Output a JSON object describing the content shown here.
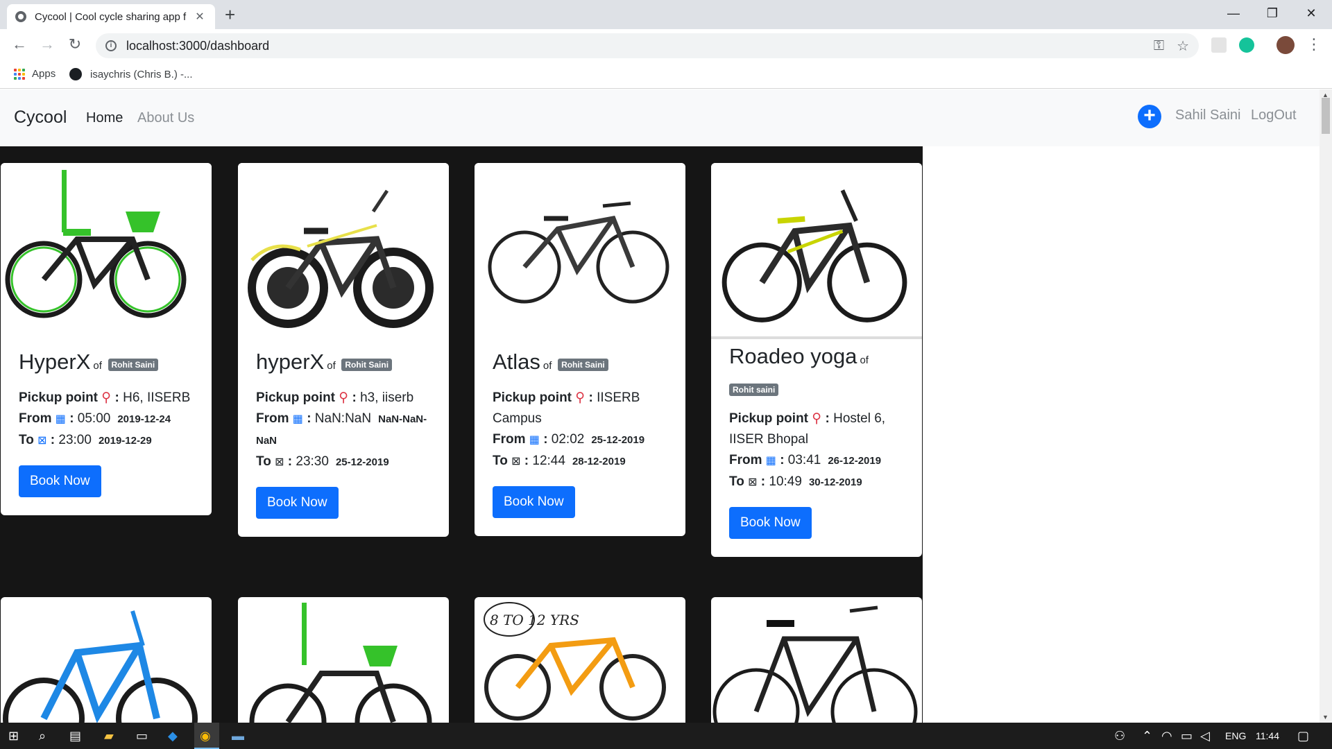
{
  "browser": {
    "tab_title": "Cycool | Cool cycle sharing app f",
    "new_tab": "+",
    "url": "localhost:3000/dashboard",
    "bookmarks": [
      {
        "label": "Apps"
      },
      {
        "label": "isaychris (Chris B.) -..."
      }
    ]
  },
  "navbar": {
    "brand": "Cycool",
    "links": [
      "Home",
      "About Us"
    ],
    "user": "Sahil Saini",
    "logout": "LogOut",
    "add_symbol": "+"
  },
  "cards": [
    {
      "name": "HyperX",
      "of": "of",
      "owner": "Rohit Saini",
      "pickup_label": "Pickup point",
      "pickup": "H6, IISERB",
      "from_label": "From",
      "from_time": "05:00",
      "from_date": "2019-12-24",
      "to_label": "To",
      "to_time": "23:00",
      "to_date": "2019-12-29",
      "button": "Book Now",
      "accent": "#35c22a"
    },
    {
      "name": "hyperX",
      "of": "of",
      "owner": "Rohit Saini",
      "pickup_label": "Pickup point",
      "pickup": "h3, iiserb",
      "from_label": "From",
      "from_time": "NaN:NaN",
      "from_date": "NaN-NaN-NaN",
      "to_label": "To",
      "to_time": "23:30",
      "to_date": "25-12-2019",
      "button": "Book Now",
      "accent": "#e8e04a"
    },
    {
      "name": "Atlas",
      "of": "of",
      "owner": "Rohit Saini",
      "pickup_label": "Pickup point",
      "pickup": "IISERB Campus",
      "from_label": "From",
      "from_time": "02:02",
      "from_date": "25-12-2019",
      "to_label": "To",
      "to_time": "12:44",
      "to_date": "28-12-2019",
      "button": "Book Now",
      "accent": "#444444"
    },
    {
      "name": "Roadeo yoga",
      "of": "of",
      "owner": "Rohit saini",
      "pickup_label": "Pickup point",
      "pickup": "Hostel 6, IISER Bhopal",
      "from_label": "From",
      "from_time": "03:41",
      "from_date": "26-12-2019",
      "to_label": "To",
      "to_time": "10:49",
      "to_date": "30-12-2019",
      "button": "Book Now",
      "accent": "#c8d400"
    }
  ],
  "row2_accents": [
    "#1e88e5",
    "#35c22a",
    "#f39c12",
    "#222222"
  ],
  "row2_badge": "8 TO 12 YRS",
  "taskbar": {
    "lang": "ENG",
    "time": "11:44"
  }
}
